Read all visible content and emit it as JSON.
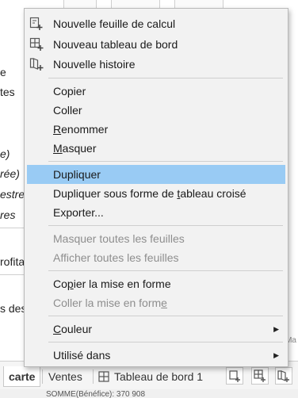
{
  "background": {
    "left_fragments": [
      "e",
      "tes",
      "e)",
      "rée)",
      "estre",
      "res",
      "rofita",
      "s des"
    ],
    "right_fragment": "Ma",
    "tabs": {
      "active": "carte",
      "second": "Ventes",
      "third": "Tableau de bord 1"
    },
    "status_text": "SOMME(Bénéfice): 370 908"
  },
  "context_menu": {
    "groups": [
      [
        {
          "label": "Nouvelle feuille de calcul",
          "icon": "new-worksheet-icon"
        },
        {
          "label": "Nouveau tableau de bord",
          "icon": "new-dashboard-icon"
        },
        {
          "label": "Nouvelle histoire",
          "icon": "new-story-icon"
        }
      ],
      [
        {
          "label": "Copier"
        },
        {
          "label": "Coller"
        },
        {
          "label_parts": [
            "",
            "R",
            "enommer"
          ]
        },
        {
          "label_parts": [
            "",
            "M",
            "asquer"
          ]
        }
      ],
      [
        {
          "label": "Dupliquer",
          "highlighted": true
        },
        {
          "label_parts": [
            "Dupliquer sous forme de ",
            "t",
            "ableau croisé"
          ]
        },
        {
          "label": "Exporter..."
        }
      ],
      [
        {
          "label": "Masquer toutes les feuilles",
          "disabled": true
        },
        {
          "label": "Afficher toutes les feuilles",
          "disabled": true
        }
      ],
      [
        {
          "label_parts": [
            "Co",
            "p",
            "ier la mise en forme"
          ]
        },
        {
          "label_parts": [
            "Coller la mise en form",
            "e",
            ""
          ],
          "disabled": true
        }
      ],
      [
        {
          "label_parts": [
            "",
            "C",
            "ouleur"
          ],
          "submenu": true
        }
      ],
      [
        {
          "label": "Utilisé dans",
          "submenu": true
        }
      ]
    ]
  },
  "colors": {
    "highlight": "#99cbf4",
    "menu_background": "#f2f2f2",
    "disabled_text": "#8e8e8e"
  }
}
